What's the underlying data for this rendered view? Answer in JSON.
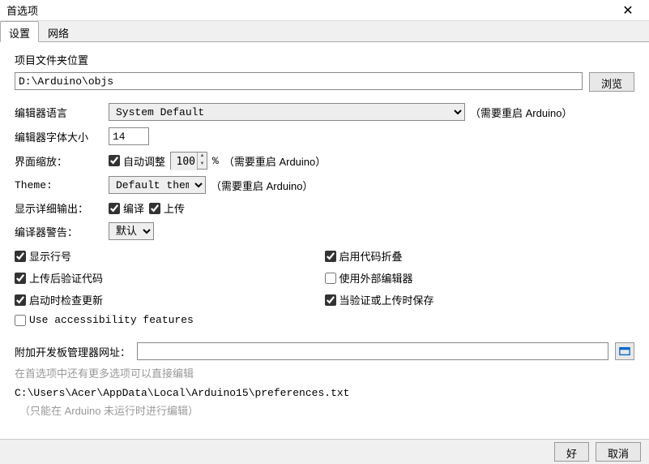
{
  "window": {
    "title": "首选项"
  },
  "tabs": {
    "settings": "设置",
    "network": "网络"
  },
  "section": {
    "sketchbook_label": "项目文件夹位置",
    "sketchbook_path": "D:\\Arduino\\objs",
    "browse": "浏览"
  },
  "editor": {
    "language_label": "编辑器语言",
    "language_value": "System Default",
    "restart_note": "（需要重启 Arduino）",
    "fontsize_label": "编辑器字体大小",
    "fontsize_value": "14"
  },
  "scale": {
    "label": "界面缩放：",
    "auto_label": "自动调整",
    "auto_checked": true,
    "value": "100",
    "percent": "%",
    "restart_note": "（需要重启 Arduino）"
  },
  "theme": {
    "label": "Theme:",
    "value": "Default theme",
    "restart_note": "（需要重启 Arduino）"
  },
  "verbose": {
    "label": "显示详细输出：",
    "compile_label": "编译",
    "compile_checked": true,
    "upload_label": "上传",
    "upload_checked": true
  },
  "warnings": {
    "label": "编译器警告：",
    "value": "默认"
  },
  "checks": {
    "linenumbers": {
      "label": "显示行号",
      "checked": true
    },
    "verify": {
      "label": "上传后验证代码",
      "checked": true
    },
    "checkupdates": {
      "label": "启动时检查更新",
      "checked": true
    },
    "codefold": {
      "label": "启用代码折叠",
      "checked": true
    },
    "external": {
      "label": "使用外部编辑器",
      "checked": false
    },
    "saveverify": {
      "label": "当验证或上传时保存",
      "checked": true
    },
    "accessibility": {
      "label": "Use accessibility features",
      "checked": false
    }
  },
  "boards_url": {
    "label": "附加开发板管理器网址：",
    "value": ""
  },
  "more_prefs_hint": "在首选项中还有更多选项可以直接编辑",
  "prefs_path": "C:\\Users\\Acer\\AppData\\Local\\Arduino15\\preferences.txt",
  "prefs_note": "（只能在 Arduino 未运行时进行编辑）",
  "footer": {
    "ok": "好",
    "cancel": "取消"
  }
}
